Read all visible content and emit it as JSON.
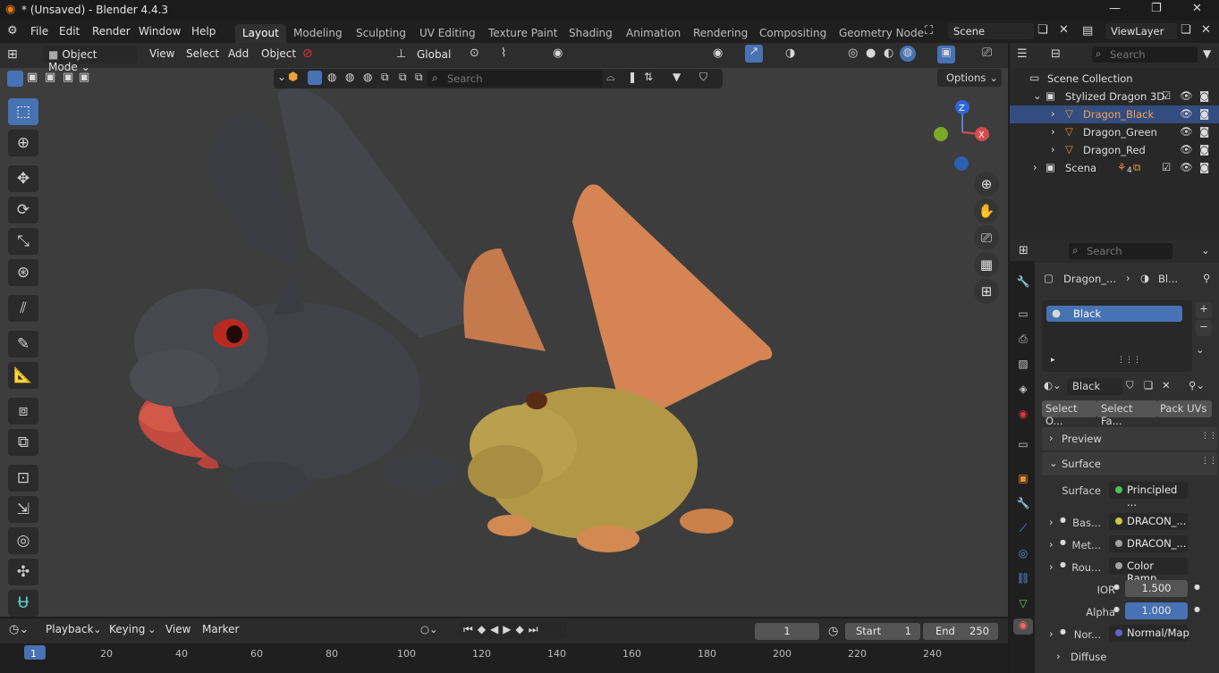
{
  "window": {
    "title": "* (Unsaved) - Blender 4.4.3"
  },
  "menu": [
    "File",
    "Edit",
    "Render",
    "Window",
    "Help"
  ],
  "workspaces": [
    "Layout",
    "Modeling",
    "Sculpting",
    "UV Editing",
    "Texture Paint",
    "Shading",
    "Animation",
    "Rendering",
    "Compositing",
    "Geometry Node"
  ],
  "scene": {
    "label": "Scene",
    "viewlayer": "ViewLayer"
  },
  "viewport": {
    "mode": "Object Mode",
    "menus": [
      "View",
      "Select",
      "Add",
      "Object"
    ],
    "orientation": "Global",
    "search_placeholder": "Search",
    "options": "Options",
    "gizmo": {
      "z": "Z",
      "x": "X"
    }
  },
  "outliner": {
    "search_placeholder": "Search",
    "collection": "Scene Collection",
    "items": [
      {
        "name": "Stylized Dragon 3D"
      },
      {
        "name": "Dragon_Black"
      },
      {
        "name": "Dragon_Green"
      },
      {
        "name": "Dragon_Red"
      },
      {
        "name": "Scena",
        "badge": "4"
      }
    ]
  },
  "properties": {
    "search_placeholder": "Search",
    "breadcrumb": [
      "Dragon_...",
      "Bl..."
    ],
    "material_slot": "Black",
    "material_name": "Black",
    "buttons": [
      "Select O...",
      "Select Fa...",
      "Pack UVs"
    ],
    "panels": {
      "preview": "Preview",
      "surface": "Surface",
      "diffuse": "Diffuse"
    },
    "rows": [
      {
        "label": "Surface",
        "value": "Principled ...",
        "dot": "#4fbf5a"
      },
      {
        "label": "Bas...",
        "value": "DRACON_...",
        "dot": "#c7c74a"
      },
      {
        "label": "Met...",
        "value": "DRACON_...",
        "dot": "#a1a1a1"
      },
      {
        "label": "Rou...",
        "value": "Color Ramp",
        "dot": "#a1a1a1"
      },
      {
        "label": "IOR",
        "value": "1.500",
        "dot": "#a1a1a1"
      },
      {
        "label": "Alpha",
        "value": "1.000",
        "dot": "#a1a1a1"
      },
      {
        "label": "Nor...",
        "value": "Normal/Map",
        "dot": "#6363c7"
      }
    ]
  },
  "timeline": {
    "menus": [
      "Playback",
      "Keying",
      "View",
      "Marker"
    ],
    "current_frame": "1",
    "start_label": "Start",
    "start": "1",
    "end_label": "End",
    "end": "250",
    "ticks": [
      "1",
      "20",
      "40",
      "60",
      "80",
      "100",
      "120",
      "140",
      "160",
      "180",
      "200",
      "220",
      "240"
    ]
  },
  "colors": {
    "accent": "#4772b3",
    "selection": "#334d80",
    "viewport_bg": "#3d3d3d"
  }
}
